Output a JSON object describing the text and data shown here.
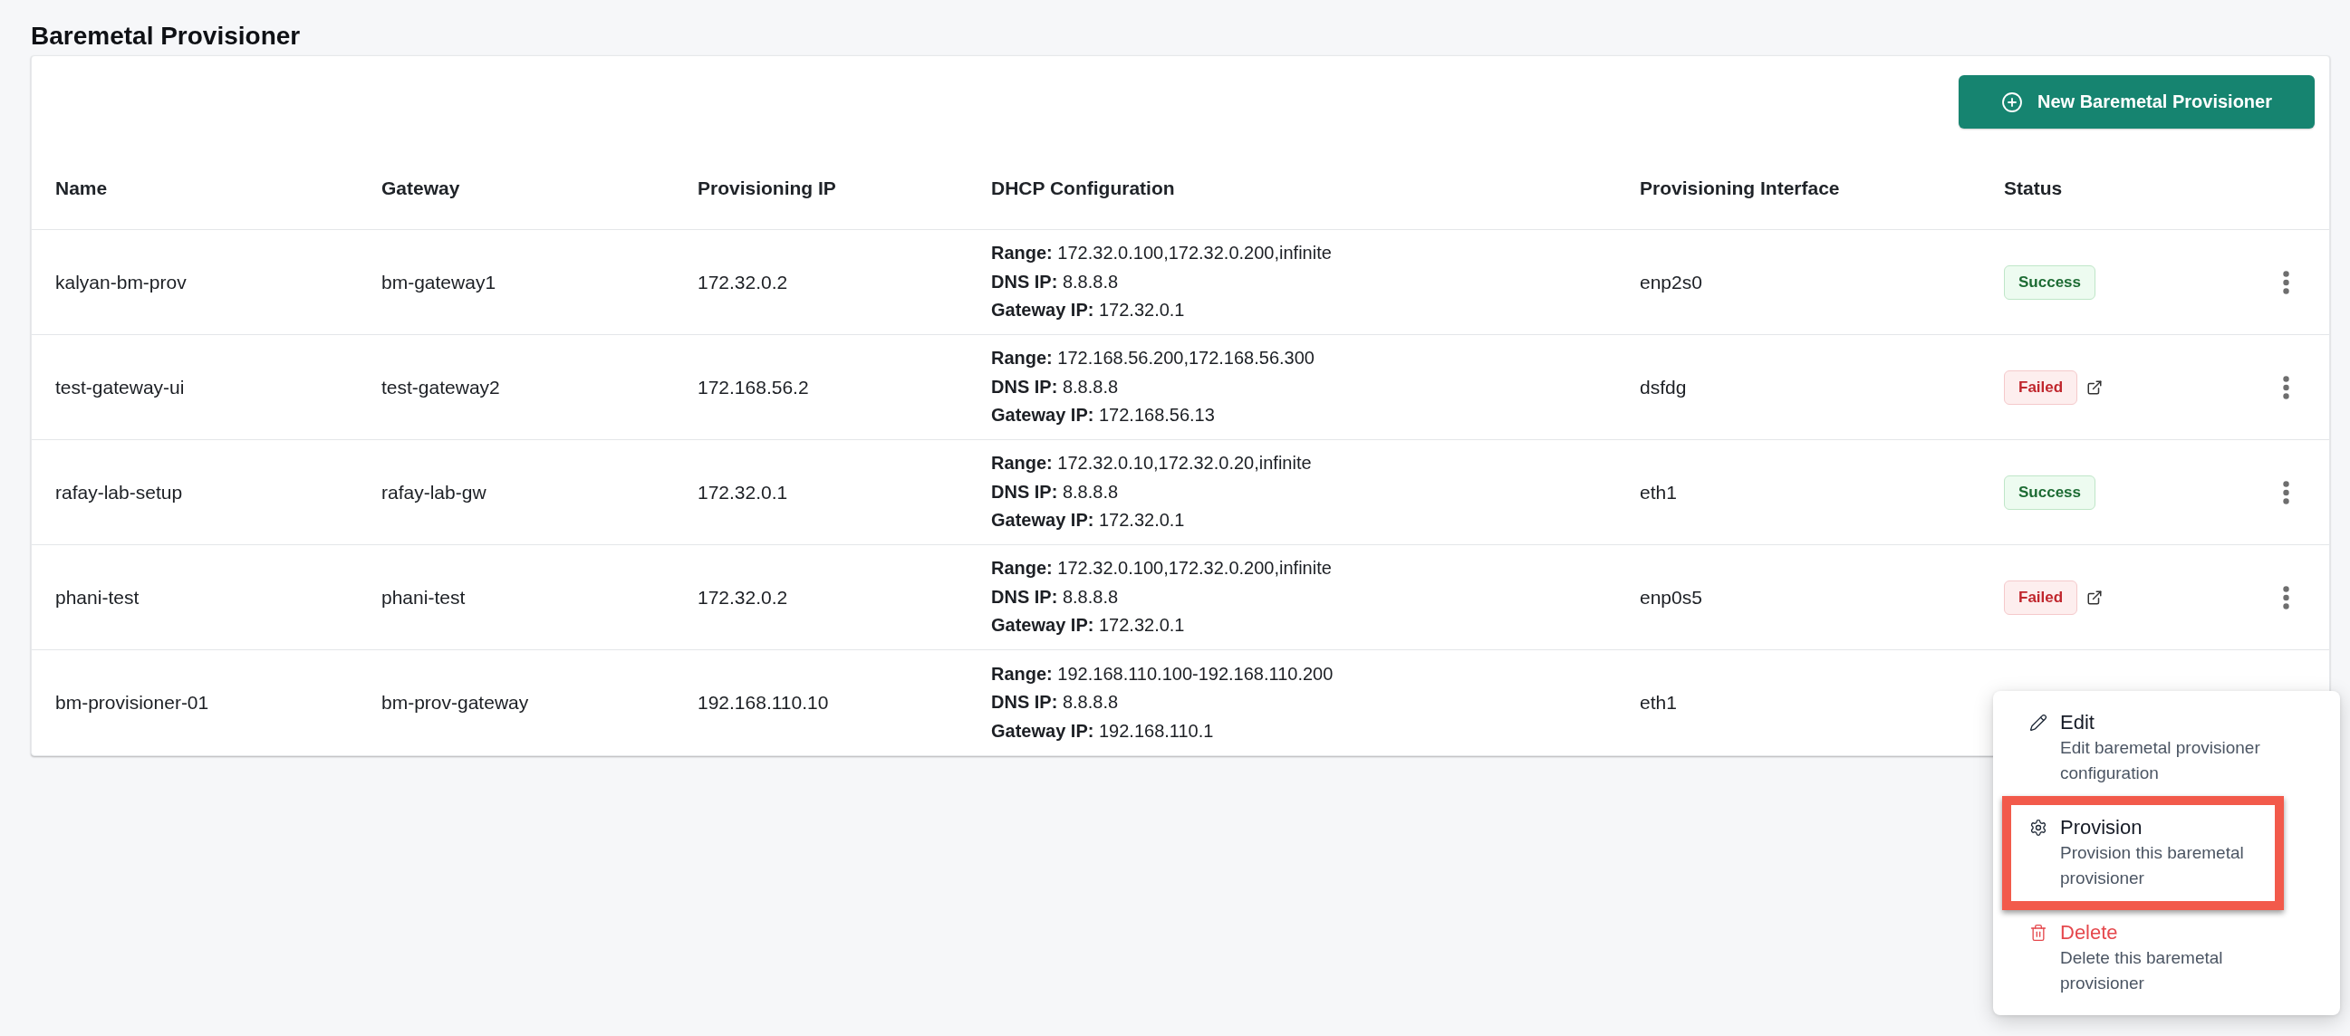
{
  "page": {
    "title": "Baremetal Provisioner"
  },
  "toolbar": {
    "new_button": "New Baremetal Provisioner"
  },
  "table": {
    "columns": [
      "Name",
      "Gateway",
      "Provisioning IP",
      "DHCP Configuration",
      "Provisioning Interface",
      "Status"
    ],
    "rows": [
      {
        "name": "kalyan-bm-prov",
        "gateway": "bm-gateway1",
        "provisioning_ip": "172.32.0.2",
        "dhcp": [
          {
            "label": "Range:",
            "value": "172.32.0.100,172.32.0.200,infinite"
          },
          {
            "label": "DNS IP:",
            "value": "8.8.8.8"
          },
          {
            "label": "Gateway IP:",
            "value": "172.32.0.1"
          }
        ],
        "interface": "enp2s0",
        "status": {
          "label": "Success",
          "kind": "success",
          "details_link": false
        },
        "menu_open": false
      },
      {
        "name": "test-gateway-ui",
        "gateway": "test-gateway2",
        "provisioning_ip": "172.168.56.2",
        "dhcp": [
          {
            "label": "Range:",
            "value": "172.168.56.200,172.168.56.300"
          },
          {
            "label": "DNS IP:",
            "value": "8.8.8.8"
          },
          {
            "label": "Gateway IP:",
            "value": "172.168.56.13"
          }
        ],
        "interface": "dsfdg",
        "status": {
          "label": "Failed",
          "kind": "failed",
          "details_link": true
        },
        "menu_open": false
      },
      {
        "name": "rafay-lab-setup",
        "gateway": "rafay-lab-gw",
        "provisioning_ip": "172.32.0.1",
        "dhcp": [
          {
            "label": "Range:",
            "value": "172.32.0.10,172.32.0.20,infinite"
          },
          {
            "label": "DNS IP:",
            "value": "8.8.8.8"
          },
          {
            "label": "Gateway IP:",
            "value": "172.32.0.1"
          }
        ],
        "interface": "eth1",
        "status": {
          "label": "Success",
          "kind": "success",
          "details_link": false
        },
        "menu_open": false
      },
      {
        "name": "phani-test",
        "gateway": "phani-test",
        "provisioning_ip": "172.32.0.2",
        "dhcp": [
          {
            "label": "Range:",
            "value": "172.32.0.100,172.32.0.200,infinite"
          },
          {
            "label": "DNS IP:",
            "value": "8.8.8.8"
          },
          {
            "label": "Gateway IP:",
            "value": "172.32.0.1"
          }
        ],
        "interface": "enp0s5",
        "status": {
          "label": "Failed",
          "kind": "failed",
          "details_link": true
        },
        "menu_open": false
      },
      {
        "name": "bm-provisioner-01",
        "gateway": "bm-prov-gateway",
        "provisioning_ip": "192.168.110.10",
        "dhcp": [
          {
            "label": "Range:",
            "value": "192.168.110.100-192.168.110.200"
          },
          {
            "label": "DNS IP:",
            "value": "8.8.8.8"
          },
          {
            "label": "Gateway IP:",
            "value": "192.168.110.1"
          }
        ],
        "interface": "eth1",
        "menu_open": true
      }
    ]
  },
  "row_menu": {
    "items": [
      {
        "kind": "edit",
        "label": "Edit",
        "description": "Edit baremetal provisioner configuration",
        "danger": false,
        "highlighted": false
      },
      {
        "kind": "provision",
        "label": "Provision",
        "description": "Provision this baremetal provisioner",
        "danger": false,
        "highlighted": true
      },
      {
        "kind": "delete",
        "label": "Delete",
        "description": "Delete this baremetal provisioner",
        "danger": true,
        "highlighted": false
      }
    ]
  }
}
